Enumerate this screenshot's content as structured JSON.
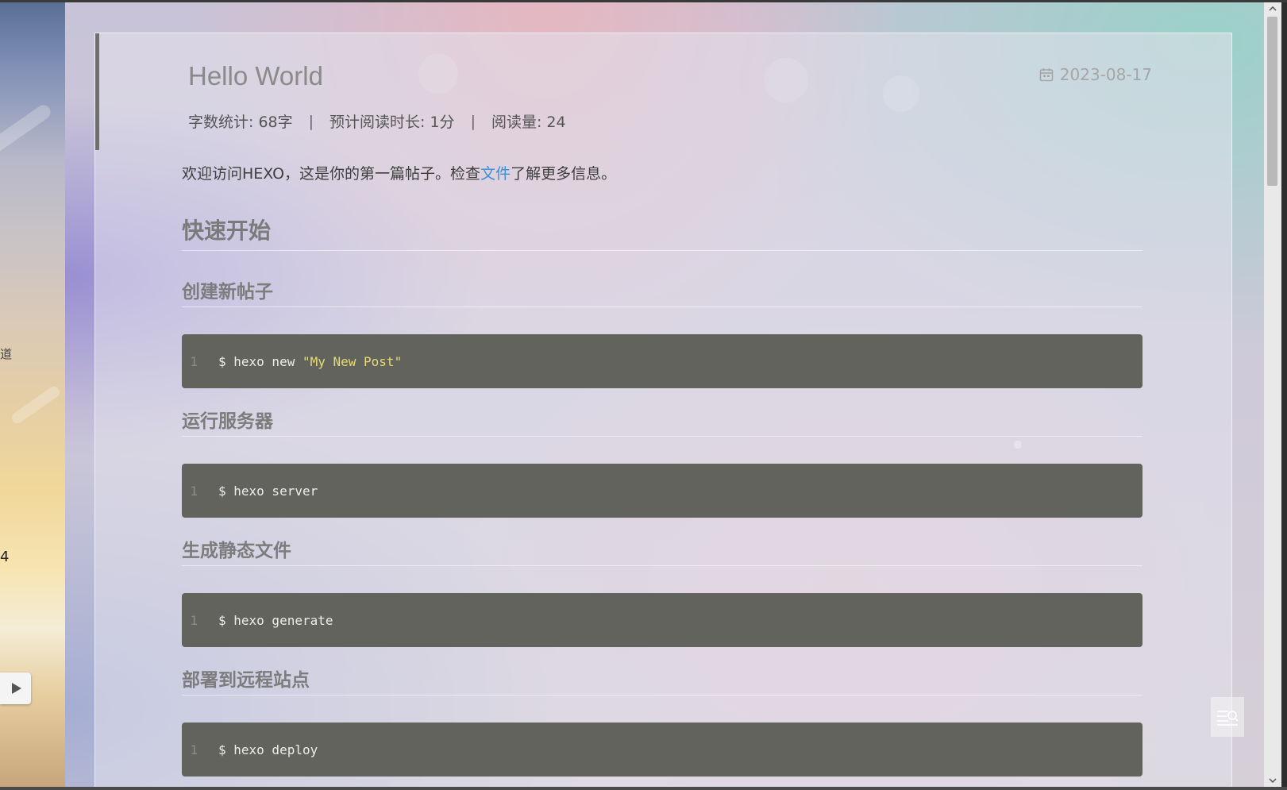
{
  "post": {
    "title": "Hello World",
    "date": "2023-08-17",
    "meta": {
      "word_count": "字数统计: 68字",
      "read_time": "预计阅读时长: 1分",
      "views": "阅读量: 24",
      "separator": "|"
    },
    "intro_before": "欢迎访问HEXO，这是你的第一篇帖子。检查",
    "intro_link": "文件",
    "intro_after": "了解更多信息。",
    "heading": "快速开始",
    "sections": [
      {
        "title": "创建新帖子",
        "line": "1",
        "code": "$ hexo new ",
        "code_string": "\"My New Post\""
      },
      {
        "title": "运行服务器",
        "line": "1",
        "code": "$ hexo server",
        "code_string": ""
      },
      {
        "title": "生成静态文件",
        "line": "1",
        "code": "$ hexo generate",
        "code_string": ""
      },
      {
        "title": "部署到远程站点",
        "line": "1",
        "code": "$ hexo deploy",
        "code_string": ""
      }
    ]
  },
  "sidebar_fragments": {
    "text_1": "道",
    "text_2": "4"
  },
  "icons": {
    "date": "calendar-icon",
    "play": "play-icon",
    "toc": "toc-search-icon"
  },
  "colors": {
    "link": "#3b8fd6",
    "code_bg": "#63635e",
    "code_string": "#e6db74"
  }
}
